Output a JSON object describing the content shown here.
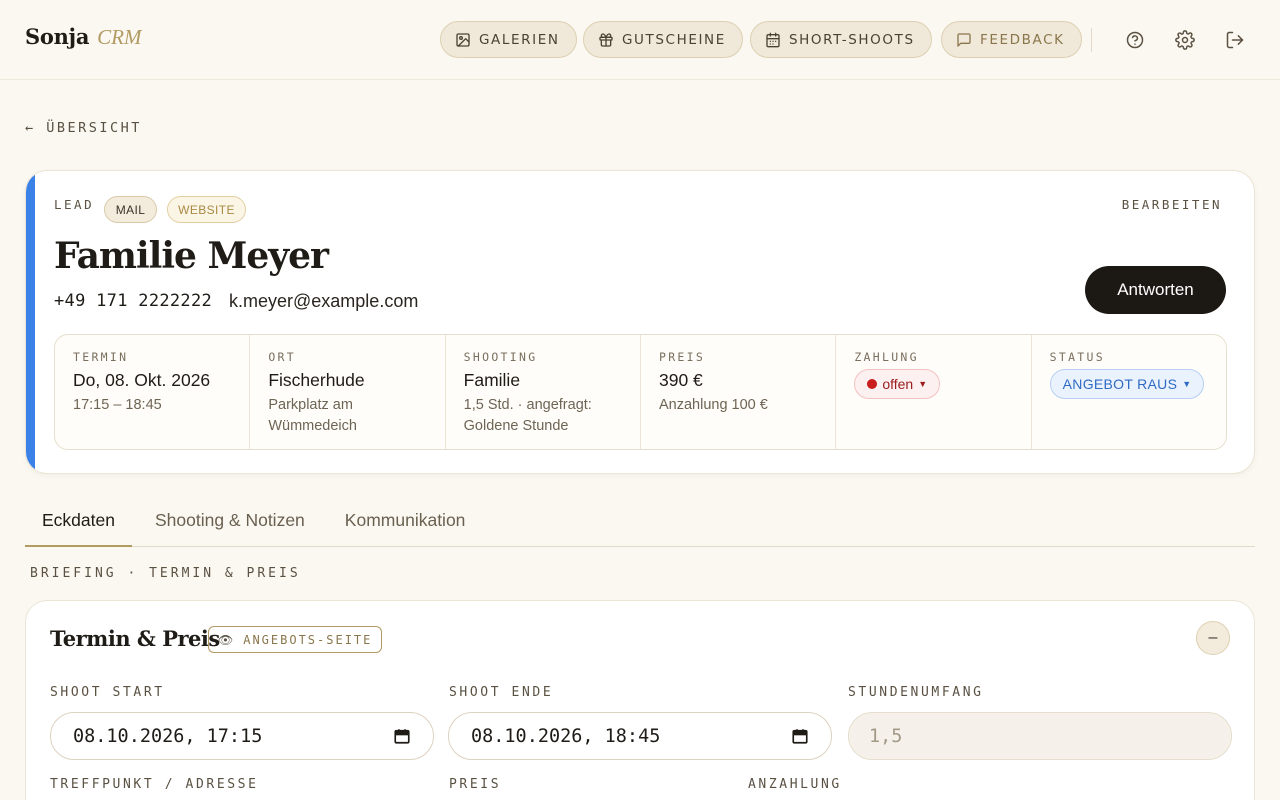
{
  "brand": {
    "name": "Sonja",
    "sub": "CRM"
  },
  "nav": [
    {
      "label": "GALERIEN",
      "icon": "image-icon"
    },
    {
      "label": "GUTSCHEINE",
      "icon": "gift-icon"
    },
    {
      "label": "SHORT-SHOOTS",
      "icon": "calendar-icon"
    },
    {
      "label": "FEEDBACK",
      "icon": "message-icon"
    }
  ],
  "top_icons": [
    "help-icon",
    "settings-icon",
    "logout-icon"
  ],
  "back_link": "← ÜBERSICHT",
  "lead": {
    "label": "LEAD",
    "tags": [
      "MAIL",
      "WEBSITE"
    ],
    "edit_label": "BEARBEITEN",
    "name": "Familie Meyer",
    "phone": "+49 171 2222222",
    "email": "k.meyer@example.com",
    "reply_label": "Antworten",
    "accent_color": "#3b82e8",
    "info": {
      "termin": {
        "label": "TERMIN",
        "value": "Do, 08. Okt. 2026",
        "sub": "17:15 – 18:45"
      },
      "ort": {
        "label": "ORT",
        "value": "Fischerhude",
        "sub": "Parkplatz am Wümmedeich"
      },
      "shooting": {
        "label": "SHOOTING",
        "value": "Familie",
        "sub": "1,5 Std. · angefragt: Goldene Stunde"
      },
      "preis": {
        "label": "PREIS",
        "value": "390 €",
        "sub": "Anzahlung 100 €"
      },
      "zahlung": {
        "label": "ZAHLUNG",
        "value": "offen",
        "color": "#c81e1e"
      },
      "status": {
        "label": "STATUS",
        "value": "ANGEBOT RAUS",
        "color": "#2f6bc4"
      }
    }
  },
  "tabs": [
    "Eckdaten",
    "Shooting & Notizen",
    "Kommunikation"
  ],
  "active_tab": "Eckdaten",
  "section_eyebrow": "BRIEFING · TERMIN & PREIS",
  "termin_card": {
    "title": "Termin & Preis",
    "chip": "ANGEBOTS-SEITE",
    "collapse_label": "–",
    "fields": {
      "shoot_start": {
        "label": "SHOOT START",
        "value": "08.10.2026, 17:15"
      },
      "shoot_ende": {
        "label": "SHOOT ENDE",
        "value": "08.10.2026, 18:45"
      },
      "stundenumfang": {
        "label": "STUNDENUMFANG",
        "value": "1,5"
      },
      "treffpunkt": {
        "label": "TREFFPUNKT / ADRESSE"
      },
      "preis": {
        "label": "PREIS"
      },
      "anzahlung": {
        "label": "ANZAHLUNG"
      }
    }
  }
}
